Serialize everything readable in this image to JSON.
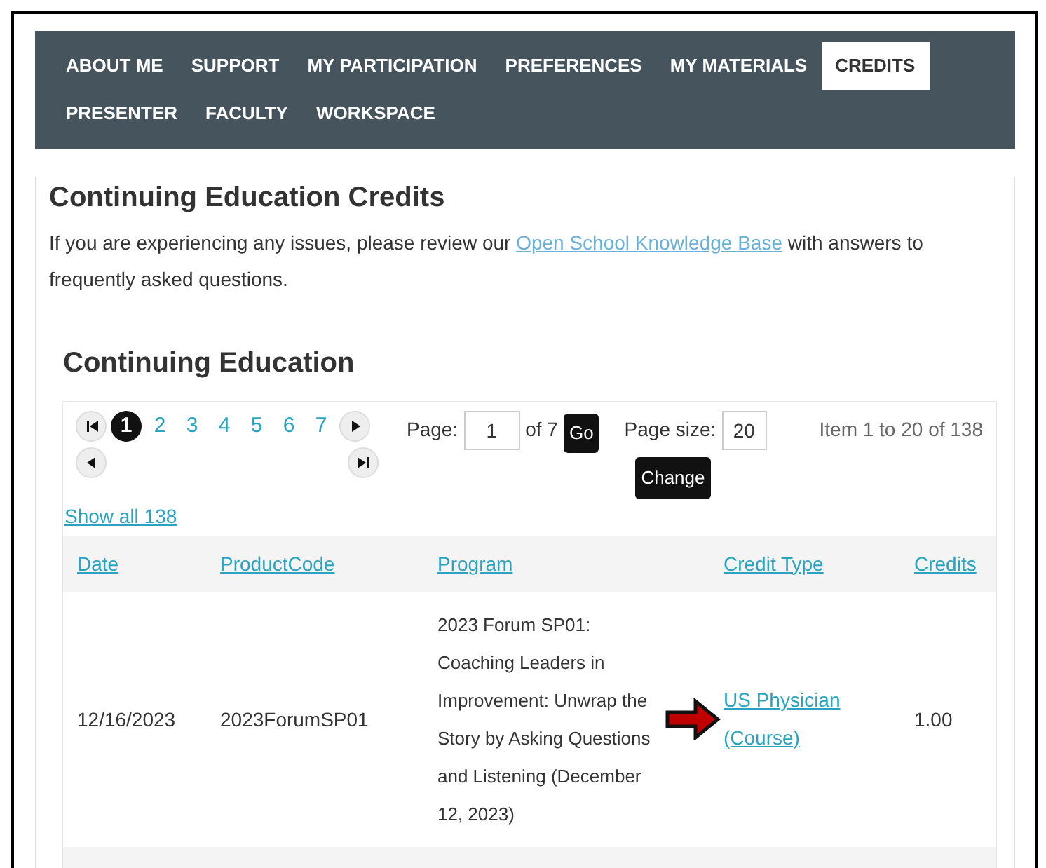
{
  "nav": {
    "tabs": [
      {
        "label": "ABOUT ME",
        "selected": false
      },
      {
        "label": "SUPPORT",
        "selected": false
      },
      {
        "label": "MY PARTICIPATION",
        "selected": false
      },
      {
        "label": "PREFERENCES",
        "selected": false
      },
      {
        "label": "MY MATERIALS",
        "selected": false
      },
      {
        "label": "CREDITS",
        "selected": true
      },
      {
        "label": "PRESENTER",
        "selected": false
      },
      {
        "label": "FACULTY",
        "selected": false
      },
      {
        "label": "WORKSPACE",
        "selected": false
      }
    ]
  },
  "title": "Continuing Education Credits",
  "intro": {
    "before": "If you are experiencing any issues, please review our ",
    "link": "Open School Knowledge Base",
    "after": " with answers to frequently asked questions."
  },
  "section_title": "Continuing Education",
  "pager": {
    "pages": [
      {
        "label": "1",
        "selected": true
      },
      {
        "label": "2",
        "selected": false
      },
      {
        "label": "3",
        "selected": false
      },
      {
        "label": "4",
        "selected": false
      },
      {
        "label": "5",
        "selected": false
      },
      {
        "label": "6",
        "selected": false
      },
      {
        "label": "7",
        "selected": false
      }
    ],
    "page_label": "Page:",
    "page_value": "1",
    "of_label": "of 7",
    "go": "Go",
    "size_label": "Page size:",
    "size_value": "20",
    "change": "Change",
    "summary": "Item 1 to 20 of 138"
  },
  "show_all": "Show all 138",
  "table": {
    "columns": [
      "Date",
      "ProductCode",
      "Program",
      "Credit Type",
      "Credits"
    ],
    "rows": [
      {
        "date": "12/16/2023",
        "code": "2023ForumSP01",
        "program": "2023 Forum SP01: Coaching Leaders in Improvement: Unwrap the Story by Asking Questions and Listening (December 12, 2023)",
        "credit_type": "US Physician (Course)",
        "credits": "1.00"
      }
    ]
  }
}
